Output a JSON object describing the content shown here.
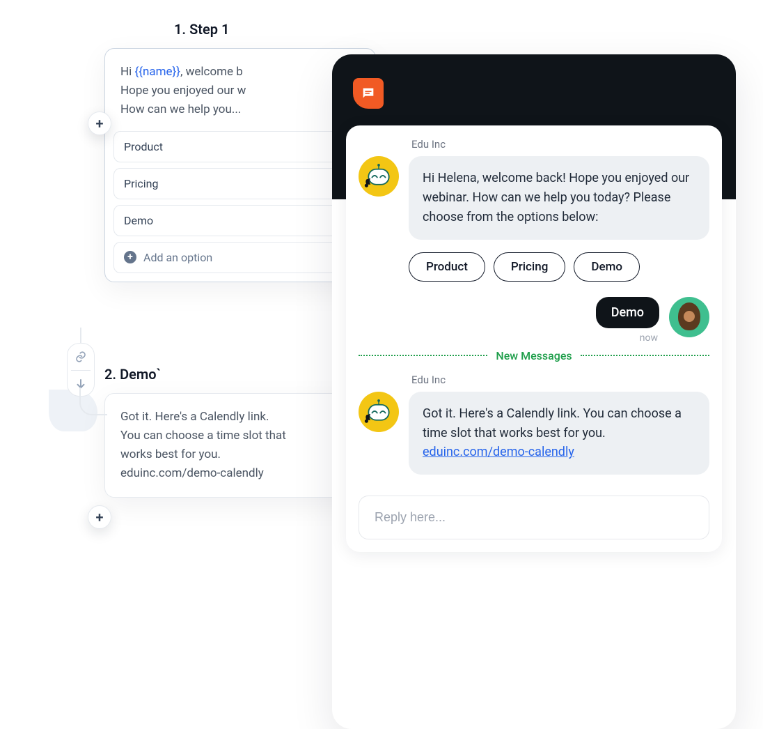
{
  "flow": {
    "step1": {
      "title": "1. Step 1",
      "body_prefix": "Hi ",
      "body_token": "{{name}}",
      "body_line1_suffix": ", welcome b",
      "body_line2": "Hope you enjoyed our w",
      "body_line3": "How can we help you...",
      "options": [
        "Product",
        "Pricing",
        "Demo"
      ],
      "add_option_label": "Add an option"
    },
    "step2": {
      "title": "2. Demo`",
      "body_line1": "Got it. Here's a Calendly link.",
      "body_line2": "You can choose a time slot that",
      "body_line3": "works best for you.",
      "body_line4": "eduinc.com/demo-calendly"
    }
  },
  "chat": {
    "sender_name": "Edu Inc",
    "message1": "Hi Helena, welcome back! Hope you enjoyed our webinar. How can we help you today? Please choose from the options below:",
    "chips": [
      "Product",
      "Pricing",
      "Demo"
    ],
    "user_reply": "Demo",
    "user_timestamp": "now",
    "new_messages_label": "New Messages",
    "message2_text": "Got it. Here's a Calendly link. You can choose a time slot that works best for you.",
    "message2_link": "eduinc.com/demo-calendly",
    "reply_placeholder": "Reply here..."
  }
}
